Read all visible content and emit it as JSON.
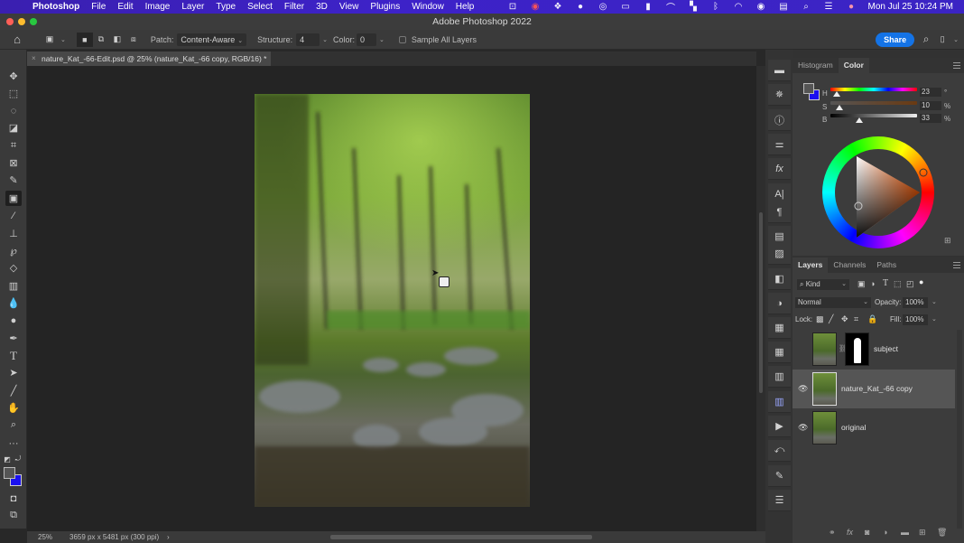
{
  "menubar": {
    "app": "Photoshop",
    "items": [
      "File",
      "Edit",
      "Image",
      "Layer",
      "Type",
      "Select",
      "Filter",
      "3D",
      "View",
      "Plugins",
      "Window",
      "Help"
    ],
    "status_icons": [
      "screen-record-icon",
      "creative-cloud-icon",
      "dropbox-icon",
      "grid-app-icon",
      "screencast-icon",
      "airplay-icon",
      "bookmark-icon",
      "arc-icon",
      "window-manager-icon",
      "bluetooth-icon",
      "wifi-icon",
      "user-icon",
      "display-icon",
      "spotlight-search-icon",
      "control-center-icon",
      "siri-icon"
    ],
    "clock": "Mon Jul 25  10:24 PM"
  },
  "window": {
    "title": "Adobe Photoshop 2022"
  },
  "options_bar": {
    "patch_label": "Patch:",
    "patch_value": "Content-Aware",
    "structure_label": "Structure:",
    "structure_value": "4",
    "color_label": "Color:",
    "color_value": "0",
    "sample_all_layers": "Sample All Layers",
    "sample_all_layers_checked": false,
    "share": "Share"
  },
  "document": {
    "tab_title": "nature_Kat_-66-Edit.psd @ 25% (nature_Kat_-66 copy, RGB/16) *",
    "zoom": "25%",
    "doc_info": "3659 px x 5481 px (300 ppi)"
  },
  "tools": [
    "move-tool",
    "rectangular-marquee-tool",
    "lasso-tool",
    "object-selection-tool",
    "crop-tool",
    "frame-tool",
    "eyedropper-tool",
    "patch-tool",
    "brush-tool",
    "clone-stamp-tool",
    "history-brush-tool",
    "eraser-tool",
    "gradient-tool",
    "blur-tool",
    "dodge-tool",
    "pen-tool",
    "type-tool",
    "path-selection-tool",
    "line-tool",
    "hand-tool",
    "zoom-tool",
    "edit-toolbar",
    "swap-colors",
    "foreground-color",
    "background-color",
    "quick-mask",
    "screen-mode"
  ],
  "colors": {
    "foreground": "#555555",
    "background": "#1a10f0",
    "accent": "#1473e6"
  },
  "color_panel": {
    "tabs": [
      "Histogram",
      "Color"
    ],
    "active_tab": "Color",
    "h_label": "H",
    "h_value": "23",
    "h_unit": "°",
    "s_label": "S",
    "s_value": "10",
    "s_unit": "%",
    "b_label": "B",
    "b_value": "33",
    "b_unit": "%"
  },
  "layers_panel": {
    "tabs": [
      "Layers",
      "Channels",
      "Paths"
    ],
    "active_tab": "Layers",
    "filter_kind": "Kind",
    "blend_mode": "Normal",
    "opacity_label": "Opacity:",
    "opacity": "100%",
    "lock_label": "Lock:",
    "fill_label": "Fill:",
    "fill": "100%",
    "layers": [
      {
        "name": "subject",
        "visible": false,
        "has_mask": true,
        "selected": false
      },
      {
        "name": "nature_Kat_-66 copy",
        "visible": true,
        "has_mask": false,
        "selected": true
      },
      {
        "name": "original",
        "visible": true,
        "has_mask": false,
        "selected": false
      }
    ]
  }
}
